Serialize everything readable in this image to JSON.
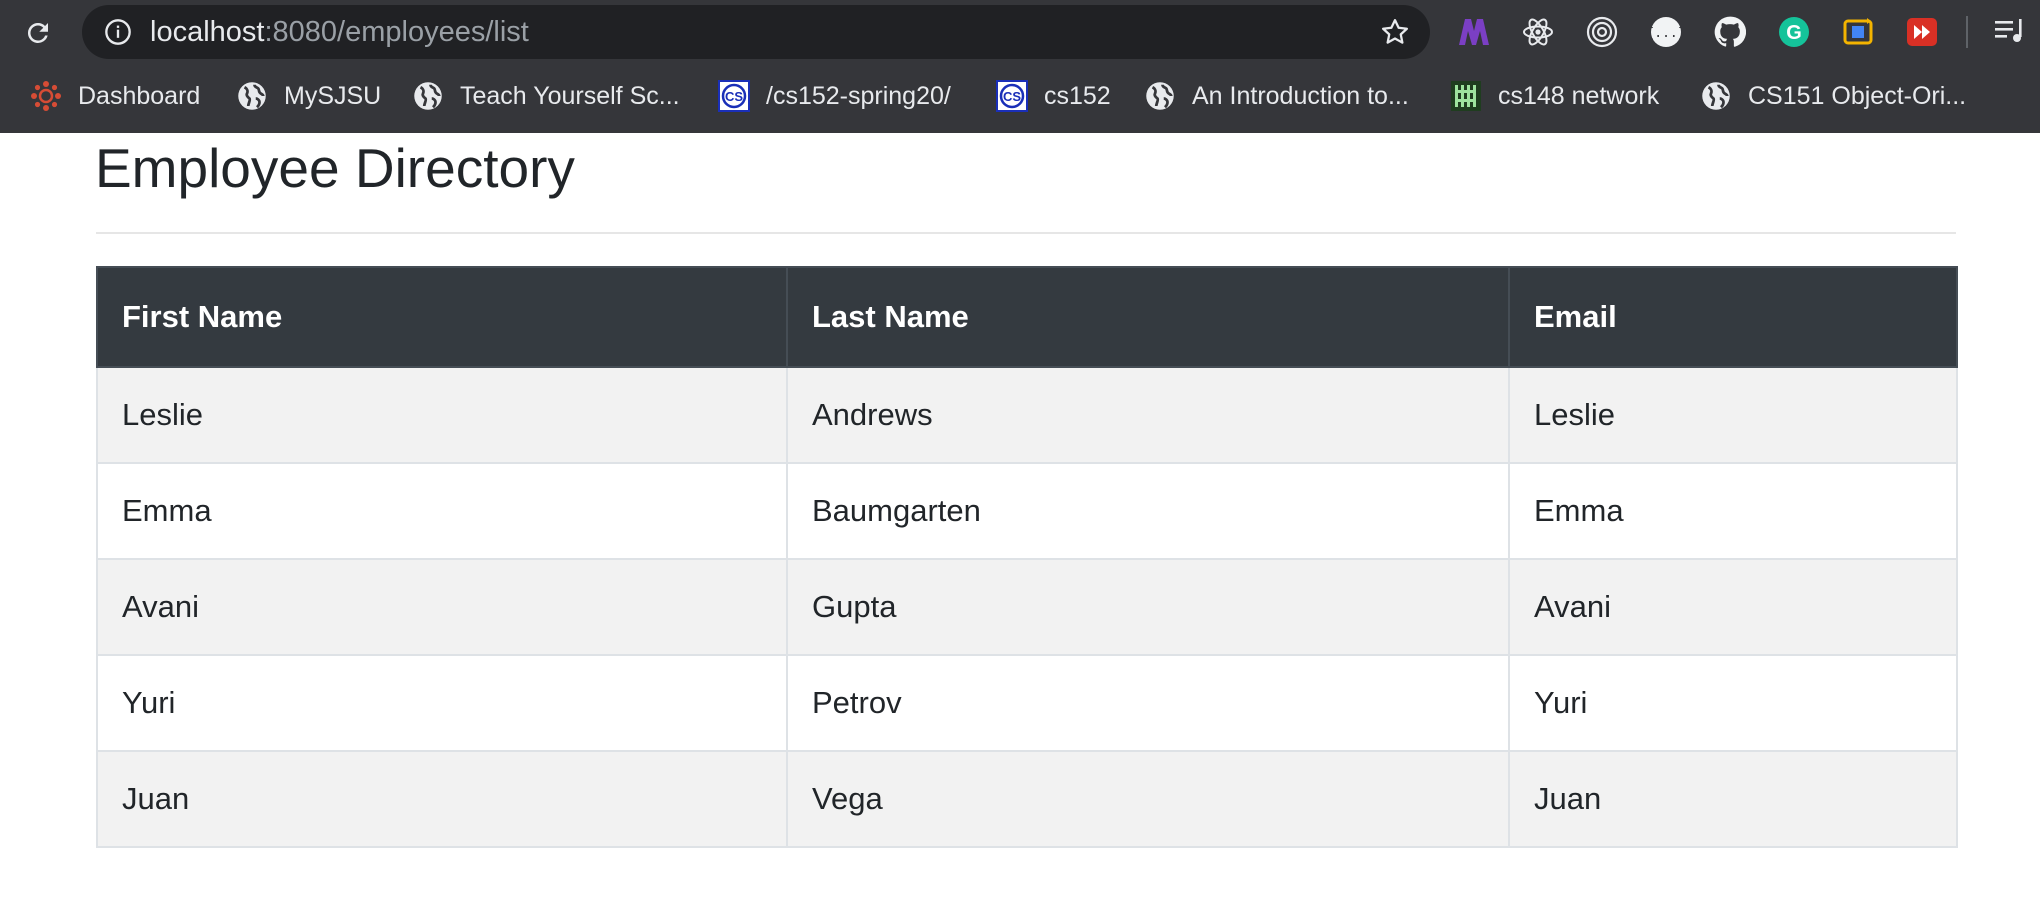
{
  "browser": {
    "url_host": "localhost",
    "url_path": ":8080/employees/list",
    "extensions": [
      "extension-m-icon",
      "react-devtools-icon",
      "target-icon",
      "json-viewer-icon",
      "github-icon",
      "grammarly-icon",
      "sync-extension-icon",
      "video-speed-icon"
    ],
    "bookmarks": [
      {
        "label": "Dashboard",
        "icon": "canvas-icon"
      },
      {
        "label": "MySJSU",
        "icon": "globe-icon"
      },
      {
        "label": "Teach Yourself Sc...",
        "icon": "globe-icon"
      },
      {
        "label": "/cs152-spring20/",
        "icon": "cs-logo-icon"
      },
      {
        "label": "cs152",
        "icon": "cs-logo-icon"
      },
      {
        "label": "An Introduction to...",
        "icon": "globe-icon"
      },
      {
        "label": "cs148 network",
        "icon": "network-icon"
      },
      {
        "label": "CS151 Object-Ori...",
        "icon": "globe-icon"
      }
    ],
    "colors": {
      "chrome_bg": "#35363a",
      "omnibox_bg": "#202124"
    }
  },
  "page": {
    "title": "Employee Directory",
    "table": {
      "headers": [
        "First Name",
        "Last Name",
        "Email"
      ],
      "rows": [
        [
          "Leslie",
          "Andrews",
          "Leslie"
        ],
        [
          "Emma",
          "Baumgarten",
          "Emma"
        ],
        [
          "Avani",
          "Gupta",
          "Avani"
        ],
        [
          "Yuri",
          "Petrov",
          "Yuri"
        ],
        [
          "Juan",
          "Vega",
          "Juan"
        ]
      ]
    },
    "colors": {
      "table_header_bg": "#343a40",
      "striped_row_bg": "#f2f2f2"
    }
  }
}
